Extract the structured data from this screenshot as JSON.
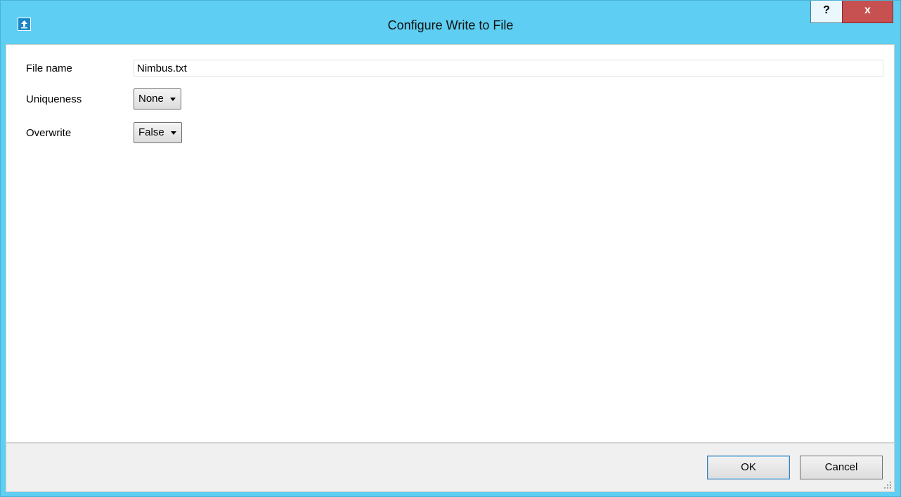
{
  "window": {
    "title": "Configure Write to File",
    "icon": "app-upload-icon",
    "help_label": "?",
    "close_label": "x"
  },
  "form": {
    "file_name": {
      "label": "File name",
      "value": "Nimbus.txt"
    },
    "uniqueness": {
      "label": "Uniqueness",
      "selected": "None"
    },
    "overwrite": {
      "label": "Overwrite",
      "selected": "False"
    }
  },
  "footer": {
    "ok_label": "OK",
    "cancel_label": "Cancel"
  },
  "colors": {
    "frame": "#5ecef2",
    "close_button": "#c75050"
  }
}
